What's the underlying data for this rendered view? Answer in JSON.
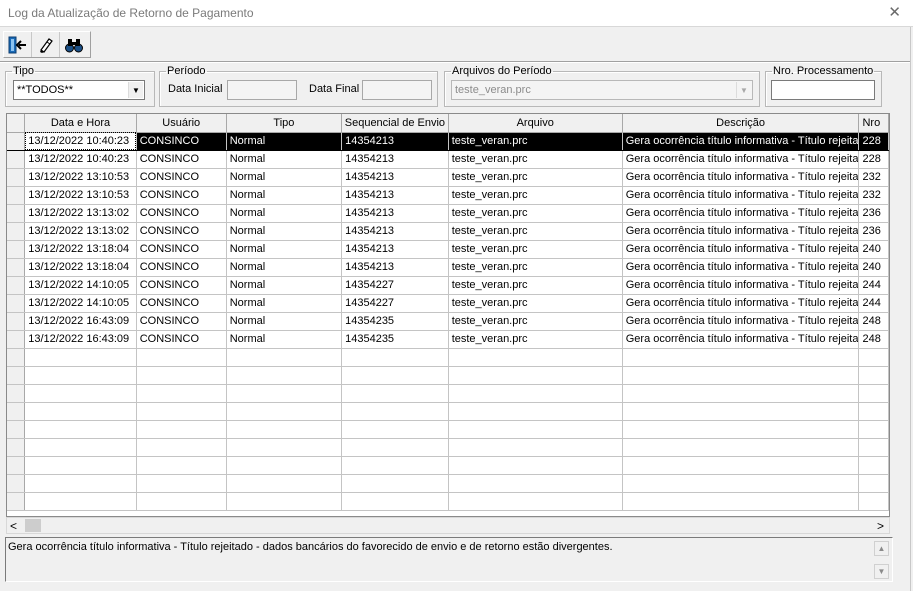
{
  "window": {
    "title": "Log da Atualização de Retorno de Pagamento",
    "close_glyph": "✕"
  },
  "toolbar": {
    "buttons": [
      {
        "icon": "exit-door-icon"
      },
      {
        "icon": "eraser-icon"
      },
      {
        "icon": "binoculars-icon"
      }
    ]
  },
  "filters": {
    "tipo": {
      "legend": "Tipo",
      "value": "**TODOS**"
    },
    "periodo": {
      "legend": "Período",
      "data_inicial_label": "Data Inicial",
      "data_inicial_value": "",
      "data_final_label": "Data Final",
      "data_final_value": ""
    },
    "arquivos": {
      "legend": "Arquivos do Período",
      "value": "teste_veran.prc"
    },
    "nro_processamento": {
      "legend": "Nro. Processamento",
      "value": ""
    }
  },
  "grid": {
    "columns": [
      "Data e Hora",
      "Usuário",
      "Tipo",
      "Sequencial de Envio",
      "Arquivo",
      "Descrição",
      "Nro"
    ],
    "rows": [
      [
        "13/12/2022 10:40:23",
        "CONSINCO",
        "Normal",
        "14354213",
        "teste_veran.prc",
        "Gera ocorrência título informativa - Título rejeita",
        "228"
      ],
      [
        "13/12/2022 10:40:23",
        "CONSINCO",
        "Normal",
        "14354213",
        "teste_veran.prc",
        "Gera ocorrência título informativa - Título rejeita",
        "228"
      ],
      [
        "13/12/2022 13:10:53",
        "CONSINCO",
        "Normal",
        "14354213",
        "teste_veran.prc",
        "Gera ocorrência título informativa - Título rejeita",
        "232"
      ],
      [
        "13/12/2022 13:10:53",
        "CONSINCO",
        "Normal",
        "14354213",
        "teste_veran.prc",
        "Gera ocorrência título informativa - Título rejeita",
        "232"
      ],
      [
        "13/12/2022 13:13:02",
        "CONSINCO",
        "Normal",
        "14354213",
        "teste_veran.prc",
        "Gera ocorrência título informativa - Título rejeita",
        "236"
      ],
      [
        "13/12/2022 13:13:02",
        "CONSINCO",
        "Normal",
        "14354213",
        "teste_veran.prc",
        "Gera ocorrência título informativa - Título rejeita",
        "236"
      ],
      [
        "13/12/2022 13:18:04",
        "CONSINCO",
        "Normal",
        "14354213",
        "teste_veran.prc",
        "Gera ocorrência título informativa - Título rejeita",
        "240"
      ],
      [
        "13/12/2022 13:18:04",
        "CONSINCO",
        "Normal",
        "14354213",
        "teste_veran.prc",
        "Gera ocorrência título informativa - Título rejeita",
        "240"
      ],
      [
        "13/12/2022 14:10:05",
        "CONSINCO",
        "Normal",
        "14354227",
        "teste_veran.prc",
        "Gera ocorrência título informativa - Título rejeita",
        "244"
      ],
      [
        "13/12/2022 14:10:05",
        "CONSINCO",
        "Normal",
        "14354227",
        "teste_veran.prc",
        "Gera ocorrência título informativa - Título rejeita",
        "244"
      ],
      [
        "13/12/2022 16:43:09",
        "CONSINCO",
        "Normal",
        "14354235",
        "teste_veran.prc",
        "Gera ocorrência título informativa - Título rejeita",
        "248"
      ],
      [
        "13/12/2022 16:43:09",
        "CONSINCO",
        "Normal",
        "14354235",
        "teste_veran.prc",
        "Gera ocorrência título informativa - Título rejeita",
        "248"
      ]
    ],
    "selected_row": 0,
    "empty_rows": 9
  },
  "scrollbar": {
    "left_glyph": "<",
    "right_glyph": ">",
    "up_glyph": "▲",
    "down_glyph": "▼"
  },
  "description": {
    "text": "Gera ocorrência título informativa - Título rejeitado - dados bancários do favorecido de envio e de retorno estão divergentes."
  },
  "colors": {
    "selection": "#000000",
    "title_text": "#7a7a7a",
    "header_bg": "#f0f0f0"
  }
}
